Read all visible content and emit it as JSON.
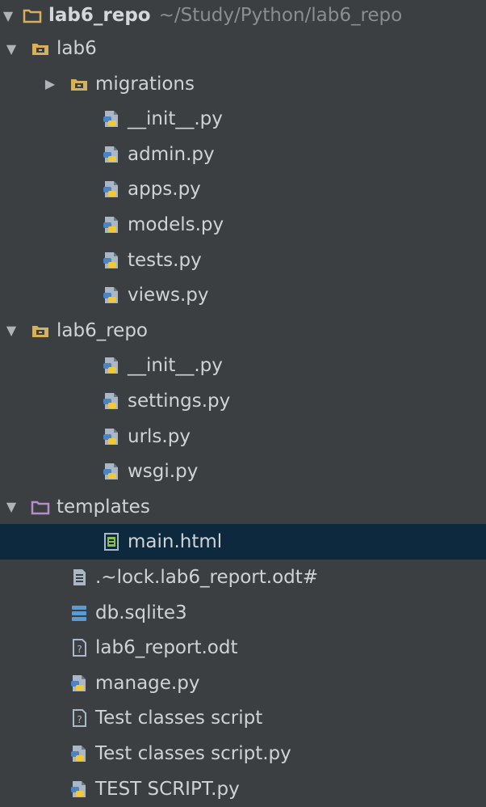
{
  "root": {
    "name": "lab6_repo",
    "path": "~/Study/Python/lab6_repo"
  },
  "items": [
    {
      "label": "lab6",
      "kind": "package",
      "expanded": true,
      "level": 1
    },
    {
      "label": "migrations",
      "kind": "package",
      "expanded": false,
      "level": 2
    },
    {
      "label": "__init__.py",
      "kind": "python",
      "level": 3
    },
    {
      "label": "admin.py",
      "kind": "python",
      "level": 3
    },
    {
      "label": "apps.py",
      "kind": "python",
      "level": 3
    },
    {
      "label": "models.py",
      "kind": "python",
      "level": 3
    },
    {
      "label": "tests.py",
      "kind": "python",
      "level": 3
    },
    {
      "label": "views.py",
      "kind": "python",
      "level": 3
    },
    {
      "label": "lab6_repo",
      "kind": "package",
      "expanded": true,
      "level": 1
    },
    {
      "label": "__init__.py",
      "kind": "python",
      "level": 3
    },
    {
      "label": "settings.py",
      "kind": "python",
      "level": 3
    },
    {
      "label": "urls.py",
      "kind": "python",
      "level": 3
    },
    {
      "label": "wsgi.py",
      "kind": "python",
      "level": 3
    },
    {
      "label": "templates",
      "kind": "templates-folder",
      "expanded": true,
      "level": 1
    },
    {
      "label": "main.html",
      "kind": "html",
      "level": 3,
      "selected": true
    },
    {
      "label": ".~lock.lab6_report.odt#",
      "kind": "text",
      "level": 2
    },
    {
      "label": "db.sqlite3",
      "kind": "database",
      "level": 2
    },
    {
      "label": "lab6_report.odt",
      "kind": "unknown",
      "level": 2
    },
    {
      "label": "manage.py",
      "kind": "python",
      "level": 2
    },
    {
      "label": "Test classes script",
      "kind": "unknown",
      "level": 2
    },
    {
      "label": "Test classes script.py",
      "kind": "python",
      "level": 2
    },
    {
      "label": "TEST SCRIPT.py",
      "kind": "python",
      "level": 2
    }
  ],
  "colors": {
    "background": "#3c3f41",
    "selection": "#0d293e",
    "text": "#cfd3d6",
    "package_folder": "#d7b05a",
    "templates_folder": "#b48ec9",
    "python_blue": "#4a84c4",
    "python_yellow": "#f0c93a",
    "html_green": "#87c04a",
    "database_blue": "#5b9bd5"
  },
  "icons": {
    "package": "package-folder-icon",
    "templates-folder": "templates-folder-icon",
    "python": "python-file-icon",
    "html": "html-file-icon",
    "text": "text-file-icon",
    "database": "database-icon",
    "unknown": "unknown-file-icon"
  }
}
